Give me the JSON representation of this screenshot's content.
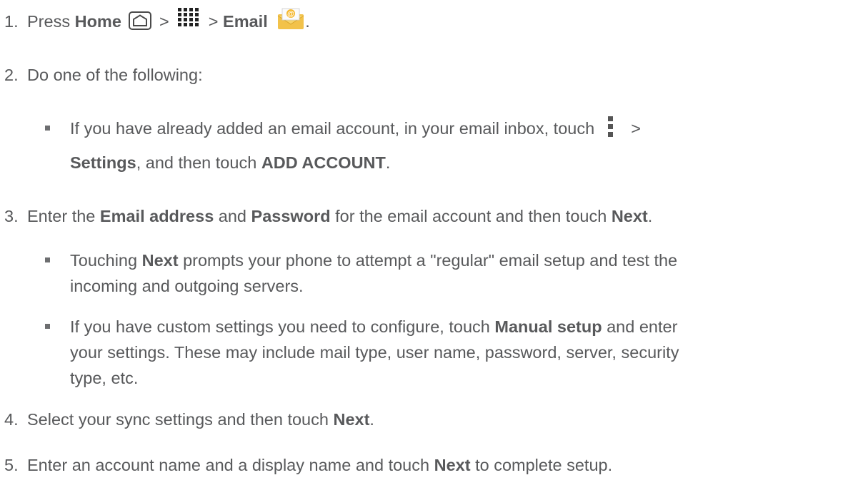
{
  "steps": [
    {
      "num": "1.",
      "press": "Press",
      "home": "Home",
      "sep1": ">",
      "sep2": ">",
      "email": "Email",
      "end": "."
    },
    {
      "num": "2.",
      "text": "Do one of the following:"
    },
    {
      "num": "3.",
      "p1": "Enter the",
      "b1": "Email address",
      "p2": "and",
      "b2": "Password",
      "p3": "for the email account and then touch",
      "b3": "Next",
      "end": "."
    },
    {
      "num": "4.",
      "p1": "Select your sync settings and then touch",
      "b1": "Next",
      "end": "."
    },
    {
      "num": "5.",
      "p1": "Enter an account name and a display name and touch",
      "b1": "Next",
      "p2": "to complete setup."
    }
  ],
  "step2_bullet": {
    "line1": "If you have already added an email account, in your email inbox, touch",
    "sep": ">",
    "b1": "Settings",
    "p1": ", and then touch",
    "b2": "ADD ACCOUNT",
    "end": "."
  },
  "step3_bullets": [
    {
      "p0": "Touching",
      "b1": "Next",
      "line1": "prompts your phone to attempt a \"regular\" email setup and test the",
      "line2": "incoming and outgoing servers."
    },
    {
      "line1": "If you have custom settings you need to configure, touch",
      "b1": "Manual setup",
      "line1b": "and enter",
      "line2": "your settings. These may include mail type, user name, password, server, security",
      "line3": "type, etc."
    }
  ],
  "icons": {
    "home": "home-key-icon",
    "apps": "apps-grid-icon",
    "email": "email-app-icon",
    "menu": "overflow-menu-icon"
  },
  "colors": {
    "text": "#58595b",
    "email_icon": "#f5c542"
  }
}
